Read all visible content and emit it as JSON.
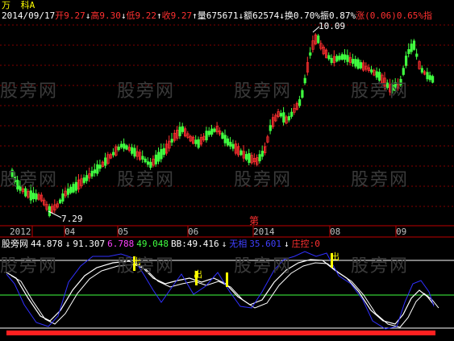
{
  "stock": {
    "name_part1": "万",
    "name_part2": "科A"
  },
  "header": [
    {
      "text": "2014/09/17",
      "color": "#ffffff"
    },
    {
      "text": "开9.27",
      "color": "#ff3030"
    },
    {
      "text": "↓",
      "color": "#ffffff"
    },
    {
      "text": "高9.30",
      "color": "#ff3030"
    },
    {
      "text": "↓",
      "color": "#ffffff"
    },
    {
      "text": "低9.22",
      "color": "#ff3030"
    },
    {
      "text": "↑",
      "color": "#ffffff"
    },
    {
      "text": "收9.27",
      "color": "#ff3030"
    },
    {
      "text": "↑",
      "color": "#ffffff"
    },
    {
      "text": "量675671",
      "color": "#ffffff"
    },
    {
      "text": "↓",
      "color": "#ffffff"
    },
    {
      "text": "额62574",
      "color": "#ffffff"
    },
    {
      "text": "↓",
      "color": "#ffffff"
    },
    {
      "text": "换0.70%",
      "color": "#ffffff"
    },
    {
      "text": "振0.87%",
      "color": "#ffffff"
    },
    {
      "text": "涨(0.06)0.65%",
      "color": "#ff3030"
    },
    {
      "text": "指",
      "color": "#ff3030"
    }
  ],
  "price_labels": {
    "high": "10.09",
    "low": "7.29"
  },
  "time_axis": [
    {
      "label": "2012",
      "color": "#c0c0c0"
    },
    {
      "label": "04",
      "color": "#c0c0c0"
    },
    {
      "label": "05",
      "color": "#c0c0c0"
    },
    {
      "label": "06",
      "color": "#c0c0c0"
    },
    {
      "label": "2014",
      "color": "#c0c0c0"
    },
    {
      "label": "08",
      "color": "#c0c0c0"
    },
    {
      "label": "09",
      "color": "#c0c0c0"
    }
  ],
  "marker": "第",
  "indicator": [
    {
      "text": "股旁网",
      "color": "#ffffff"
    },
    {
      "text": "44.878",
      "color": "#ffffff"
    },
    {
      "text": "↓",
      "color": "#ffffff"
    },
    {
      "text": "91.307",
      "color": "#ffffff"
    },
    {
      "text": "6.788",
      "color": "#ff40ff"
    },
    {
      "text": "49.048",
      "color": "#40ff40"
    },
    {
      "text": "BB:49.416",
      "color": "#ffffff"
    },
    {
      "text": "↓",
      "color": "#ffffff"
    },
    {
      "text": "无相",
      "color": "#4040ff"
    },
    {
      "text": "35.601",
      "color": "#4040ff"
    },
    {
      "text": "↓",
      "color": "#ffffff"
    },
    {
      "text": "庄控:0",
      "color": "#ff3030"
    }
  ],
  "signals": [
    "出",
    "出",
    "出"
  ],
  "watermark": "股旁网",
  "colors": {
    "up": "#ff3030",
    "down": "#40ff40",
    "grid": "#800000",
    "axis": "#c00000",
    "white": "#ffffff",
    "blue": "#3030ff",
    "yellow": "#ffff00"
  }
}
